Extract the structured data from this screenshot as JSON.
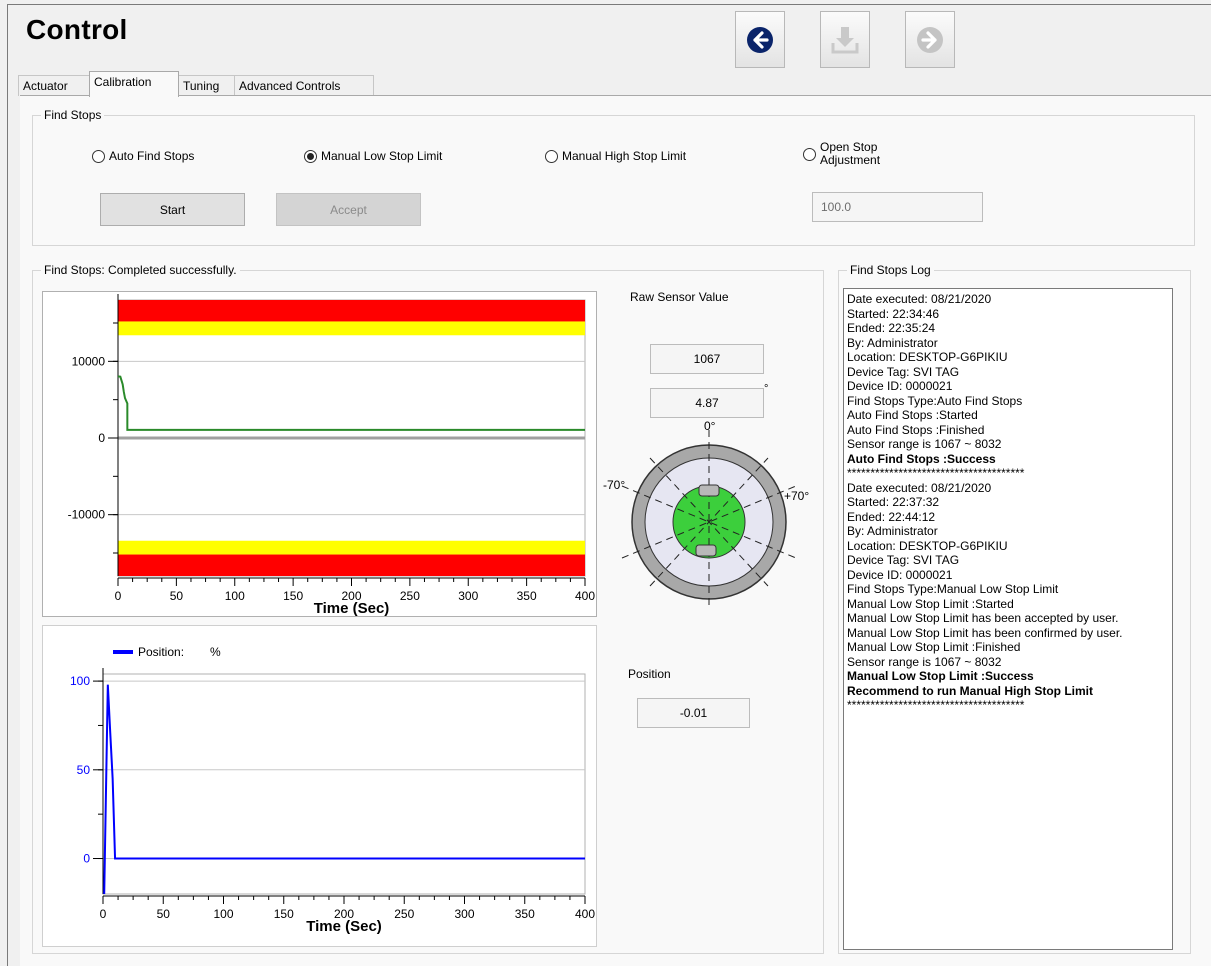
{
  "header": {
    "title": "Control",
    "toolbar": [
      {
        "name": "back",
        "icon": "arrow-left-circle-icon",
        "enabled": true
      },
      {
        "name": "download",
        "icon": "download-icon",
        "enabled": false
      },
      {
        "name": "forward",
        "icon": "arrow-right-circle-icon",
        "enabled": false
      }
    ]
  },
  "tabs": [
    {
      "label": "Actuator",
      "active": false
    },
    {
      "label": "Calibration",
      "active": true
    },
    {
      "label": "Tuning",
      "active": false
    },
    {
      "label": "Advanced Controls",
      "active": false
    }
  ],
  "find_stops": {
    "group_label": "Find Stops",
    "options": [
      {
        "label": "Auto Find Stops",
        "selected": false
      },
      {
        "label": "Manual Low Stop Limit",
        "selected": true
      },
      {
        "label": "Manual High Stop Limit",
        "selected": false
      },
      {
        "label": "Open Stop Adjustment",
        "label_line1": "Open Stop",
        "label_line2": "Adjustment",
        "selected": false
      }
    ],
    "start_label": "Start",
    "accept_label": "Accept",
    "open_stop_value": "100.0"
  },
  "status": {
    "group_label": "Find Stops: Completed successfully."
  },
  "sensor": {
    "raw_label": "Raw Sensor Value",
    "raw_value": "1067",
    "angle_value": "4.87",
    "degree_symbol": "°",
    "dial_top": "0°",
    "dial_left": "-70°",
    "dial_right": "+70°",
    "position_label": "Position",
    "position_value": "-0.01"
  },
  "log": {
    "group_label": "Find Stops Log",
    "lines": [
      {
        "text": "Date executed: 08/21/2020",
        "bold": false
      },
      {
        "text": "Started: 22:34:46",
        "bold": false
      },
      {
        "text": "Ended: 22:35:24",
        "bold": false
      },
      {
        "text": "By: Administrator",
        "bold": false
      },
      {
        "text": "Location: DESKTOP-G6PIKIU",
        "bold": false
      },
      {
        "text": "Device Tag: SVI TAG",
        "bold": false
      },
      {
        "text": "Device ID: 0000021",
        "bold": false
      },
      {
        "text": "Find Stops Type:Auto Find Stops",
        "bold": false
      },
      {
        "text": "Auto Find Stops :Started",
        "bold": false
      },
      {
        "text": "Auto Find Stops :Finished",
        "bold": false
      },
      {
        "text": "Sensor range is 1067 ~ 8032",
        "bold": false
      },
      {
        "text": "Auto Find Stops :Success",
        "bold": true
      },
      {
        "text": "**************************************",
        "bold": false
      },
      {
        "text": "Date executed: 08/21/2020",
        "bold": false
      },
      {
        "text": "Started: 22:37:32",
        "bold": false
      },
      {
        "text": "Ended: 22:44:12",
        "bold": false
      },
      {
        "text": "By: Administrator",
        "bold": false
      },
      {
        "text": "Location: DESKTOP-G6PIKIU",
        "bold": false
      },
      {
        "text": "Device Tag: SVI TAG",
        "bold": false
      },
      {
        "text": "Device ID: 0000021",
        "bold": false
      },
      {
        "text": "Find Stops Type:Manual Low Stop Limit",
        "bold": false
      },
      {
        "text": "Manual Low Stop Limit :Started",
        "bold": false
      },
      {
        "text": "Manual Low Stop Limit has been accepted by user.",
        "bold": false
      },
      {
        "text": "Manual Low Stop Limit has been confirmed by user.",
        "bold": false
      },
      {
        "text": "Manual Low Stop Limit :Finished",
        "bold": false
      },
      {
        "text": "Sensor range is 1067 ~ 8032",
        "bold": false
      },
      {
        "text": "Manual Low Stop Limit :Success",
        "bold": true
      },
      {
        "text": "Recommend to run Manual High Stop Limit",
        "bold": true
      },
      {
        "text": "**************************************",
        "bold": false
      }
    ]
  },
  "colors": {
    "accent": "#0a246a",
    "series_sensor": "#2a8a2a",
    "series_position": "#0000ff",
    "alarm_red": "#ff0000",
    "alarm_yellow": "#ffff00",
    "dial_green": "#3ccf3c"
  },
  "chart_data": [
    {
      "type": "line",
      "name": "raw-sensor-chart",
      "xlabel": "Time (Sec)",
      "ylabel": "",
      "xlim": [
        0,
        400
      ],
      "ylim": [
        -18000,
        18000
      ],
      "xticks": [
        0,
        50,
        100,
        150,
        200,
        250,
        300,
        350,
        400
      ],
      "yticks": [
        10000,
        0,
        -10000
      ],
      "ytick_labels": [
        "10000",
        "0",
        "-10000"
      ],
      "bands": [
        {
          "color": "red",
          "from": 15200,
          "to": 18000
        },
        {
          "color": "yellow",
          "from": 13400,
          "to": 15200
        },
        {
          "color": "yellow",
          "from": -15200,
          "to": -13400
        },
        {
          "color": "red",
          "from": -18000,
          "to": -15200
        }
      ],
      "series": [
        {
          "values_x": [
            0,
            2,
            4,
            5,
            6,
            8,
            8,
            400
          ],
          "values_y": [
            8032,
            8000,
            7000,
            6000,
            5200,
            4500,
            1067,
            1067
          ]
        }
      ],
      "grid": true
    },
    {
      "type": "line",
      "name": "position-chart",
      "legend": {
        "label": "Position:",
        "unit": "%",
        "placement": "top-left"
      },
      "xlabel": "Time (Sec)",
      "ylabel": "",
      "xlim": [
        0,
        400
      ],
      "ylim": [
        -20,
        104
      ],
      "xticks": [
        0,
        50,
        100,
        150,
        200,
        250,
        300,
        350,
        400
      ],
      "yticks": [
        100,
        50,
        0
      ],
      "ytick_labels": [
        "100",
        "50",
        "0"
      ],
      "series": [
        {
          "name": "Position:",
          "values_x": [
            1,
            4,
            4,
            6,
            6,
            8,
            8,
            10,
            10,
            400
          ],
          "values_y": [
            -20,
            98,
            98,
            71,
            71,
            45,
            45,
            0,
            0,
            0
          ]
        }
      ],
      "grid": true
    }
  ]
}
